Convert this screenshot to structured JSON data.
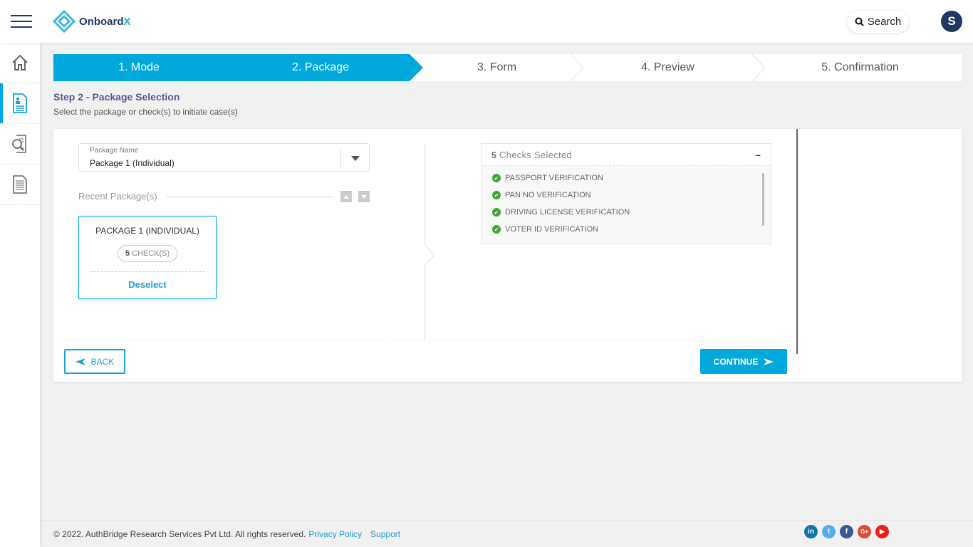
{
  "header": {
    "brand": "Onboard",
    "brand_x": "X",
    "search_label": "Search",
    "avatar_initial": "S"
  },
  "sidebar": {
    "items": [
      {
        "icon": "home-icon"
      },
      {
        "icon": "form-icon",
        "active": true
      },
      {
        "icon": "search-document-icon"
      },
      {
        "icon": "document-icon"
      }
    ]
  },
  "stepper": {
    "steps": [
      "1. Mode",
      "2. Package",
      "3. Form",
      "4. Preview",
      "5. Confirmation"
    ],
    "current": 2
  },
  "page": {
    "title": "Step 2 - Package Selection",
    "subtitle": "Select the package or check(s) to initiate case(s)"
  },
  "package_select": {
    "label": "Package Name",
    "value": "Package 1 (Individual)"
  },
  "recent": {
    "label": "Recent Package(s)"
  },
  "package_card": {
    "name": "PACKAGE 1 (INDIVIDUAL)",
    "count": "5",
    "count_label": "CHECK(S)",
    "deselect": "Deselect"
  },
  "checks": {
    "count": "5",
    "label": "Checks Selected",
    "collapse": "–",
    "items": [
      "PASSPORT VERIFICATION",
      "PAN NO VERIFICATION",
      "DRIVING LICENSE VERIFICATION",
      "VOTER ID VERIFICATION"
    ]
  },
  "buttons": {
    "back": "BACK",
    "continue": "CONTINUE"
  },
  "footer": {
    "copyright": "© 2022. AuthBridge Research Services Pvt Ltd. All rights reserved.",
    "privacy": "Privacy Policy",
    "support": "Support"
  },
  "social": [
    {
      "name": "linkedin",
      "glyph": "in",
      "color": "#0e76a8"
    },
    {
      "name": "twitter",
      "glyph": "t",
      "color": "#55acee"
    },
    {
      "name": "facebook",
      "glyph": "f",
      "color": "#3b5998"
    },
    {
      "name": "google-plus",
      "glyph": "G+",
      "color": "#dd4b39"
    },
    {
      "name": "youtube",
      "glyph": "▶",
      "color": "#e62117"
    }
  ],
  "colors": {
    "accent": "#00a8dc",
    "navy": "#1f3864",
    "check_green": "#3fa535"
  }
}
